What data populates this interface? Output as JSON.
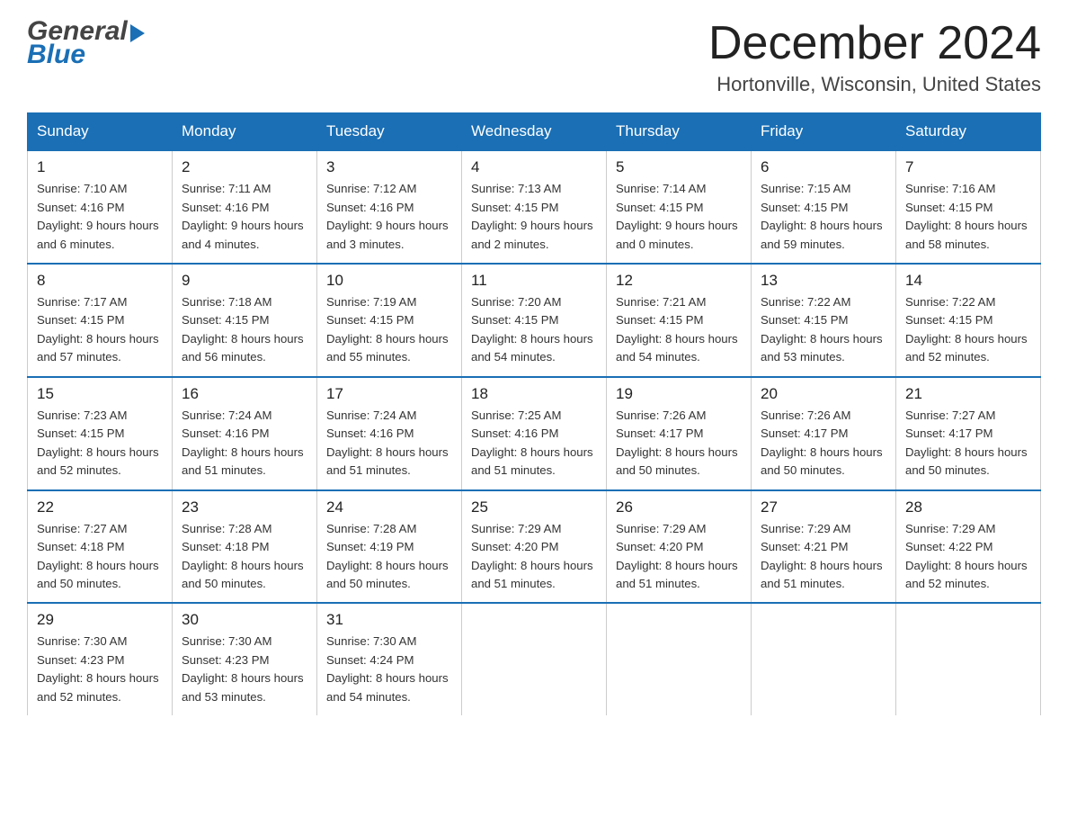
{
  "header": {
    "month_title": "December 2024",
    "location": "Hortonville, Wisconsin, United States",
    "logo_general": "General",
    "logo_blue": "Blue"
  },
  "weekdays": [
    "Sunday",
    "Monday",
    "Tuesday",
    "Wednesday",
    "Thursday",
    "Friday",
    "Saturday"
  ],
  "weeks": [
    [
      {
        "day": "1",
        "sunrise": "7:10 AM",
        "sunset": "4:16 PM",
        "daylight": "9 hours and 6 minutes."
      },
      {
        "day": "2",
        "sunrise": "7:11 AM",
        "sunset": "4:16 PM",
        "daylight": "9 hours and 4 minutes."
      },
      {
        "day": "3",
        "sunrise": "7:12 AM",
        "sunset": "4:16 PM",
        "daylight": "9 hours and 3 minutes."
      },
      {
        "day": "4",
        "sunrise": "7:13 AM",
        "sunset": "4:15 PM",
        "daylight": "9 hours and 2 minutes."
      },
      {
        "day": "5",
        "sunrise": "7:14 AM",
        "sunset": "4:15 PM",
        "daylight": "9 hours and 0 minutes."
      },
      {
        "day": "6",
        "sunrise": "7:15 AM",
        "sunset": "4:15 PM",
        "daylight": "8 hours and 59 minutes."
      },
      {
        "day": "7",
        "sunrise": "7:16 AM",
        "sunset": "4:15 PM",
        "daylight": "8 hours and 58 minutes."
      }
    ],
    [
      {
        "day": "8",
        "sunrise": "7:17 AM",
        "sunset": "4:15 PM",
        "daylight": "8 hours and 57 minutes."
      },
      {
        "day": "9",
        "sunrise": "7:18 AM",
        "sunset": "4:15 PM",
        "daylight": "8 hours and 56 minutes."
      },
      {
        "day": "10",
        "sunrise": "7:19 AM",
        "sunset": "4:15 PM",
        "daylight": "8 hours and 55 minutes."
      },
      {
        "day": "11",
        "sunrise": "7:20 AM",
        "sunset": "4:15 PM",
        "daylight": "8 hours and 54 minutes."
      },
      {
        "day": "12",
        "sunrise": "7:21 AM",
        "sunset": "4:15 PM",
        "daylight": "8 hours and 54 minutes."
      },
      {
        "day": "13",
        "sunrise": "7:22 AM",
        "sunset": "4:15 PM",
        "daylight": "8 hours and 53 minutes."
      },
      {
        "day": "14",
        "sunrise": "7:22 AM",
        "sunset": "4:15 PM",
        "daylight": "8 hours and 52 minutes."
      }
    ],
    [
      {
        "day": "15",
        "sunrise": "7:23 AM",
        "sunset": "4:15 PM",
        "daylight": "8 hours and 52 minutes."
      },
      {
        "day": "16",
        "sunrise": "7:24 AM",
        "sunset": "4:16 PM",
        "daylight": "8 hours and 51 minutes."
      },
      {
        "day": "17",
        "sunrise": "7:24 AM",
        "sunset": "4:16 PM",
        "daylight": "8 hours and 51 minutes."
      },
      {
        "day": "18",
        "sunrise": "7:25 AM",
        "sunset": "4:16 PM",
        "daylight": "8 hours and 51 minutes."
      },
      {
        "day": "19",
        "sunrise": "7:26 AM",
        "sunset": "4:17 PM",
        "daylight": "8 hours and 50 minutes."
      },
      {
        "day": "20",
        "sunrise": "7:26 AM",
        "sunset": "4:17 PM",
        "daylight": "8 hours and 50 minutes."
      },
      {
        "day": "21",
        "sunrise": "7:27 AM",
        "sunset": "4:17 PM",
        "daylight": "8 hours and 50 minutes."
      }
    ],
    [
      {
        "day": "22",
        "sunrise": "7:27 AM",
        "sunset": "4:18 PM",
        "daylight": "8 hours and 50 minutes."
      },
      {
        "day": "23",
        "sunrise": "7:28 AM",
        "sunset": "4:18 PM",
        "daylight": "8 hours and 50 minutes."
      },
      {
        "day": "24",
        "sunrise": "7:28 AM",
        "sunset": "4:19 PM",
        "daylight": "8 hours and 50 minutes."
      },
      {
        "day": "25",
        "sunrise": "7:29 AM",
        "sunset": "4:20 PM",
        "daylight": "8 hours and 51 minutes."
      },
      {
        "day": "26",
        "sunrise": "7:29 AM",
        "sunset": "4:20 PM",
        "daylight": "8 hours and 51 minutes."
      },
      {
        "day": "27",
        "sunrise": "7:29 AM",
        "sunset": "4:21 PM",
        "daylight": "8 hours and 51 minutes."
      },
      {
        "day": "28",
        "sunrise": "7:29 AM",
        "sunset": "4:22 PM",
        "daylight": "8 hours and 52 minutes."
      }
    ],
    [
      {
        "day": "29",
        "sunrise": "7:30 AM",
        "sunset": "4:23 PM",
        "daylight": "8 hours and 52 minutes."
      },
      {
        "day": "30",
        "sunrise": "7:30 AM",
        "sunset": "4:23 PM",
        "daylight": "8 hours and 53 minutes."
      },
      {
        "day": "31",
        "sunrise": "7:30 AM",
        "sunset": "4:24 PM",
        "daylight": "8 hours and 54 minutes."
      },
      null,
      null,
      null,
      null
    ]
  ],
  "labels": {
    "sunrise": "Sunrise:",
    "sunset": "Sunset:",
    "daylight": "Daylight:"
  }
}
